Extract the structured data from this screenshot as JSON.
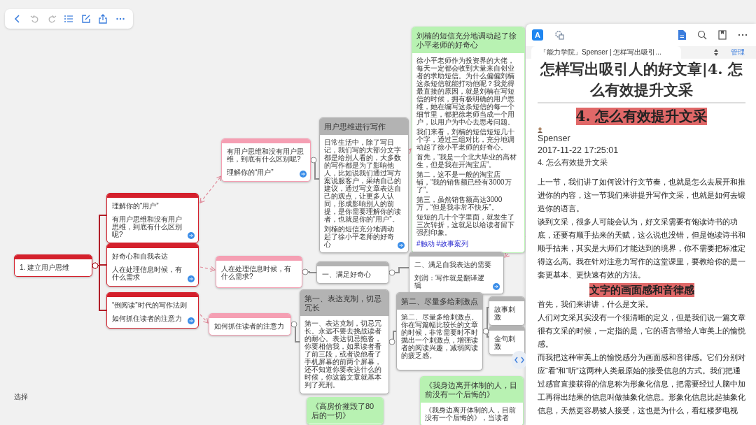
{
  "canvas": {
    "select_button": "选择",
    "nodes": [
      {
        "kind": "note",
        "color": "#d4202c",
        "lines": [
          "1. 建立用户思维"
        ],
        "link": false
      },
      {
        "kind": "note",
        "color": "#d4202c",
        "lines": [
          "理解你的“用户”",
          "有用户思维和没有用户思维，到底有什么区别呢?"
        ],
        "link": true
      },
      {
        "kind": "note",
        "color": "#d4202c",
        "lines": [
          "好奇心和自我表达",
          "人在处理信息时候，有什么需求"
        ],
        "link": true
      },
      {
        "kind": "note",
        "color": "#d4202c",
        "lines": [
          "“倒阅读”时代的写作法则",
          "如何抓住读者的注意力"
        ],
        "link": true
      },
      {
        "kind": "note",
        "color": "#f59fb3",
        "lines": [
          "有用户思维和没有用户思维，到底有什么区别呢?",
          "理解你的“用户”"
        ],
        "link": true
      },
      {
        "kind": "note",
        "color": "#f59fb3",
        "lines": [
          "人在处理信息时候，有什么需求?"
        ],
        "link": false
      },
      {
        "kind": "note",
        "color": "#f59fb3",
        "lines": [
          "如何抓住读者的注意力"
        ],
        "link": false
      },
      {
        "kind": "topic",
        "color": "#b3b3b3",
        "title": "用户思维进行写作",
        "body": [
          "日常生活中，除了写日记，我们写的大部分文字都是给别人看的，大多数的写作都是为了影响他人，比如说我们通过写方案说服客户，采纳自己的建议，通过写文章表达自己的观点，让更多人认同，形成影响别人的前提，是你需要理解你的读者，也就是你的“用户”。",
          "刘楠的短信充分地调动起了徐小平老师的好奇心"
        ],
        "link": true
      },
      {
        "kind": "topic",
        "color": "#b8f2b2",
        "title": "刘楠的短信充分地调动起了徐小平老师的好奇心",
        "body": [
          "徐小平老师作为投资界的大佬，每天一定都会收到大量来自创业者的求助短信。为什么偏偏刘楠这条短信就能打动他呢？我觉得最直接的原因，就是刘楠在写短信的时候，拥有极明确的用户思维，她在编写这条短信的每一个细节里，都把徐老师当成一个用户，以用户为中心去思考问题。",
          "我们来看，刘楠的短信短短几十个字，通过三组对比，充分地调动起了徐小平老师的好奇心。",
          "首先，“我是一个北大毕业的高材生，但是我在开淘宝店”。",
          "第二，这不是一般的淘宝店铺，“我的销售额已经有3000万了”。",
          "第三，虽然销售额高达3000万，“但是我非常不快乐”。",
          "短短的几十个字里面，就发生了三次转折，这就足以给读者留下强烈印象。"
        ],
        "tags": "#触动 #故事案列",
        "link": false
      },
      {
        "kind": "note",
        "color": "#b3b3b3",
        "lines": [
          "一、满足好奇心"
        ],
        "link": false
      },
      {
        "kind": "note",
        "color": "#b3b3b3",
        "lines": [
          "二、满足自我表达的需要",
          "刘润：写作就是翻译逻辑"
        ],
        "link": true
      },
      {
        "kind": "topic",
        "color": "#b3b3b3",
        "title": "第一、表达克制，切忌冗长",
        "body": [
          "第一、表达克制，切忌冗长。永远不要去挑战读者的耐心。表达切忌拖沓，你要相信我，如果读者看了前三段，或者说他看了手机屏幕的前两个屏幕，还不知道你要表达什么的时候，你这篇文章就基本判了死刑。"
        ],
        "link": false
      },
      {
        "kind": "topic",
        "color": "#b3b3b3",
        "title": "第二、尽量多给刺激点",
        "body": [
          "第二、尽量多给刺激点。你在写篇幅比较长的文章的时候，非常需要时不时抛出一个刺激点，增强读者的阅读兴趣，减弱阅读的疲乏感。"
        ],
        "link": false
      },
      {
        "kind": "note",
        "color": "#b3b3b3",
        "lines": [
          "故事刺激"
        ],
        "link": false
      },
      {
        "kind": "note",
        "color": "#b3b3b3",
        "lines": [
          "金句刺激"
        ],
        "link": false
      },
      {
        "kind": "topic",
        "color": "#b8f2b2",
        "title": "《高房价摧毁了80后的一切》",
        "link": false
      },
      {
        "kind": "topic",
        "color": "#b8f2b2",
        "title": "《我身边离开体制的人，目前没有一个后悔的》",
        "body": [
          "《我身边离开体制的人，目前没有一个后悔的》，当读者"
        ],
        "link": false
      }
    ]
  },
  "reader": {
    "app_icon_letter": "A",
    "tab": "「能力学院」Spenser | 怎样写出吸引...",
    "manage": "管理",
    "article": {
      "title": "怎样写出吸引人的好文章|4. 怎么有效提升文采",
      "heading": "4. 怎么有效提升文采",
      "author": "Spenser",
      "date": "2017-11-22 17:25:01",
      "subtitle": "4. 怎么有效提升文采",
      "blocks": [
        {
          "kind": "paragraph",
          "text": "上一节，我们讲了如何设计行文节奏，也就是怎么去展开和推进你的内容，这一节我们来讲提升写作文采，也就是如何去锻造你的语言。"
        },
        {
          "kind": "paragraph",
          "text": "谈到文采，很多人可能会认为，好文采需要有饱读诗书的功底，还要有顺手拈来的天赋，这么说也没错，但是饱读诗书和顺手拈来，其实是大师们才能达到的境界，你不需要把标准定得这么高。我在针对注意力写作的这堂课里，要教给你的是一套更基本、更快速有效的方法。"
        },
        {
          "kind": "heading",
          "text": "文字的画面感和音律感"
        },
        {
          "kind": "paragraph",
          "text": "首先，我们来讲讲，什么是文采。"
        },
        {
          "kind": "paragraph",
          "text": "人们对文采其实没有一个很清晰的定义，但是我们说一篇文章很有文采的时候，一定指的是，它的语言带给人审美上的愉悦感。"
        },
        {
          "kind": "paragraph",
          "text": "而我把这种审美上的愉悦感分为画面感和音律感。它们分别对应“看”和“听”这两种人类最原始的接受信息的方式。我们把通过感官直接获得的信息称为形象化信息，把需要经过人脑中加工再得出结果的信息叫做抽象化信息。形象化信息比起抽象化信息，天然更容易被人接受，这也是为什么，看红楼梦电视"
        }
      ]
    }
  }
}
